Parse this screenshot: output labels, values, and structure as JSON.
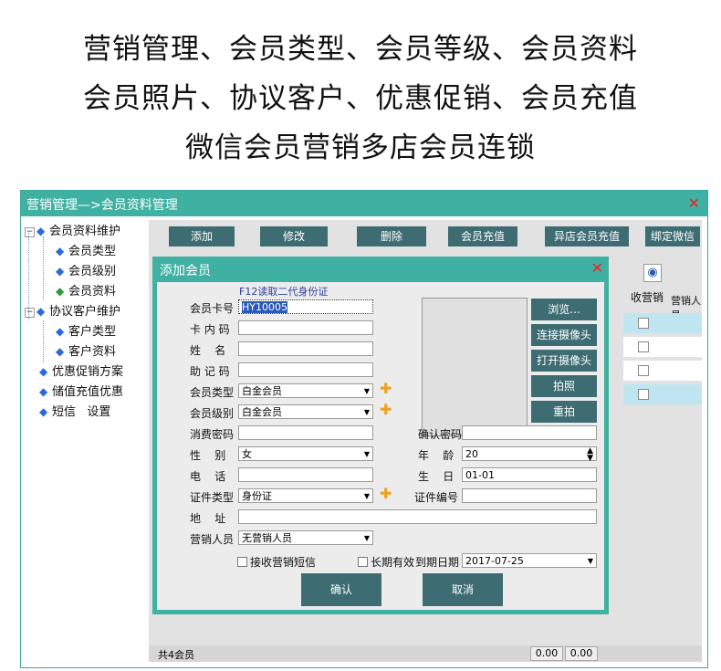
{
  "headline": {
    "line1": "营销管理、会员类型、会员等级、会员资料",
    "line2": "会员照片、协议客户、优惠促销、会员充值",
    "line3": "微信会员营销多店会员连锁"
  },
  "window": {
    "title": "营销管理—>会员资料管理",
    "close": "✕"
  },
  "tree": {
    "items": [
      {
        "label": "会员资料维护",
        "expander": "−"
      },
      {
        "label": "会员类型"
      },
      {
        "label": "会员级别"
      },
      {
        "label": "会员资料"
      },
      {
        "label": "协议客户维护",
        "expander": "−"
      },
      {
        "label": "客户类型"
      },
      {
        "label": "客户资料"
      },
      {
        "label": "优惠促销方案"
      },
      {
        "label": "储值充值优惠"
      },
      {
        "label": "短信   设置"
      }
    ]
  },
  "toolbar": {
    "add": "添加",
    "edit": "修改",
    "delete": "删除",
    "recharge": "会员充值",
    "remote_recharge": "异店会员充值",
    "bind_wechat": "绑定微信"
  },
  "table": {
    "col_sales": "收营销",
    "col_salesman": "营销人员"
  },
  "status": {
    "count": "共4会员",
    "val1": "0.00",
    "val2": "0.00"
  },
  "dialog": {
    "title": "添加会员",
    "close": "✕",
    "id_hint": "F12读取二代身份证",
    "fields": {
      "card_no": {
        "label": "会员卡号",
        "value": "HY10005"
      },
      "inner_code": {
        "label": "卡 内 码",
        "value": ""
      },
      "name": {
        "label": "姓    名",
        "value": ""
      },
      "mnemonic": {
        "label": "助 记 码",
        "value": ""
      },
      "member_type": {
        "label": "会员类型",
        "value": "白金会员"
      },
      "member_level": {
        "label": "会员级别",
        "value": "白金会员"
      },
      "password": {
        "label": "消费密码",
        "value": ""
      },
      "confirm_password": {
        "label": "确认密码",
        "value": ""
      },
      "gender": {
        "label": "性    别",
        "value": "女"
      },
      "age": {
        "label": "年    龄",
        "value": "20"
      },
      "phone": {
        "label": "电    话",
        "value": ""
      },
      "birthday": {
        "label": "生    日",
        "value": "01-01"
      },
      "id_type": {
        "label": "证件类型",
        "value": "身份证"
      },
      "id_no": {
        "label": "证件编号",
        "value": ""
      },
      "address": {
        "label": "地    址",
        "value": ""
      },
      "salesman": {
        "label": "营销人员",
        "value": "无营销人员"
      }
    },
    "photo_buttons": {
      "browse": "浏览...",
      "connect": "连接摄像头",
      "open": "打开摄像头",
      "shoot": "拍照",
      "reshoot": "重拍"
    },
    "receive_sms": "接收营销短信",
    "long_term": "长期有效",
    "expiry_label": "到期日期",
    "expiry_value": "2017-07-25",
    "confirm": "确认",
    "cancel": "取消"
  },
  "colors": {
    "accent": "#3fb1a2",
    "button": "#3d6c72"
  }
}
